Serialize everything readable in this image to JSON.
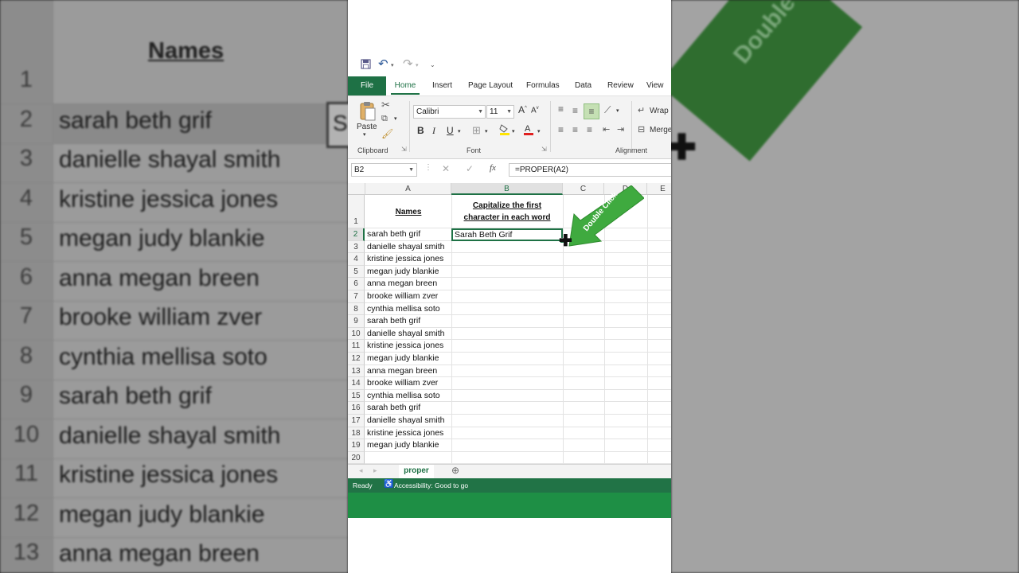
{
  "background": {
    "header": "Names",
    "rows": [
      {
        "n": "1",
        "name": ""
      },
      {
        "n": "2",
        "name": "sarah beth grif"
      },
      {
        "n": "3",
        "name": "danielle shayal smith"
      },
      {
        "n": "4",
        "name": "kristine jessica jones"
      },
      {
        "n": "5",
        "name": "megan judy blankie"
      },
      {
        "n": "6",
        "name": "anna megan breen"
      },
      {
        "n": "7",
        "name": "brooke william zver"
      },
      {
        "n": "8",
        "name": "cynthia mellisa soto"
      },
      {
        "n": "9",
        "name": "sarah beth grif"
      },
      {
        "n": "10",
        "name": "danielle shayal smith"
      },
      {
        "n": "11",
        "name": "kristine jessica jones"
      },
      {
        "n": "12",
        "name": "megan judy blankie"
      },
      {
        "n": "13",
        "name": "anna megan breen"
      }
    ],
    "cell_partial": "S",
    "arrow_text": "Double"
  },
  "ribbon": {
    "tabs": [
      "File",
      "Home",
      "Insert",
      "Page Layout",
      "Formulas",
      "Data",
      "Review",
      "View"
    ],
    "paste_label": "Paste",
    "clipboard_label": "Clipboard",
    "font_label": "Font",
    "alignment_label": "Alignment",
    "font_name": "Calibri",
    "font_size": "11",
    "bold": "B",
    "italic": "I",
    "underline": "U",
    "wrap_label": "Wrap",
    "merge_label": "Merge"
  },
  "formula_bar": {
    "name_box": "B2",
    "formula": "=PROPER(A2)",
    "fx": "fx"
  },
  "sheet": {
    "columns": [
      "A",
      "B",
      "C",
      "D",
      "E"
    ],
    "header_a": "Names",
    "header_b_line1": "Capitalize the first",
    "header_b_line2": "character in each word",
    "b2_value": "Sarah Beth Grif",
    "rows": [
      {
        "n": "1",
        "a": ""
      },
      {
        "n": "2",
        "a": "sarah beth grif"
      },
      {
        "n": "3",
        "a": "danielle shayal smith"
      },
      {
        "n": "4",
        "a": "kristine jessica jones"
      },
      {
        "n": "5",
        "a": "megan judy blankie"
      },
      {
        "n": "6",
        "a": "anna megan breen"
      },
      {
        "n": "7",
        "a": "brooke william zver"
      },
      {
        "n": "8",
        "a": "cynthia mellisa soto"
      },
      {
        "n": "9",
        "a": "sarah beth grif"
      },
      {
        "n": "10",
        "a": "danielle shayal smith"
      },
      {
        "n": "11",
        "a": "kristine jessica jones"
      },
      {
        "n": "12",
        "a": "megan judy blankie"
      },
      {
        "n": "13",
        "a": "anna megan breen"
      },
      {
        "n": "14",
        "a": "brooke william zver"
      },
      {
        "n": "15",
        "a": "cynthia mellisa soto"
      },
      {
        "n": "16",
        "a": "sarah beth grif"
      },
      {
        "n": "17",
        "a": "danielle shayal smith"
      },
      {
        "n": "18",
        "a": "kristine jessica jones"
      },
      {
        "n": "19",
        "a": "megan judy blankie"
      },
      {
        "n": "20",
        "a": ""
      }
    ],
    "arrow_label": "Double Click",
    "sheet_tab": "proper"
  },
  "status": {
    "ready": "Ready",
    "accessibility": "Accessibility: Good to go"
  },
  "colors": {
    "excel_green": "#1e7145",
    "status_green": "#217346",
    "arrow_green": "#3faa3f"
  }
}
